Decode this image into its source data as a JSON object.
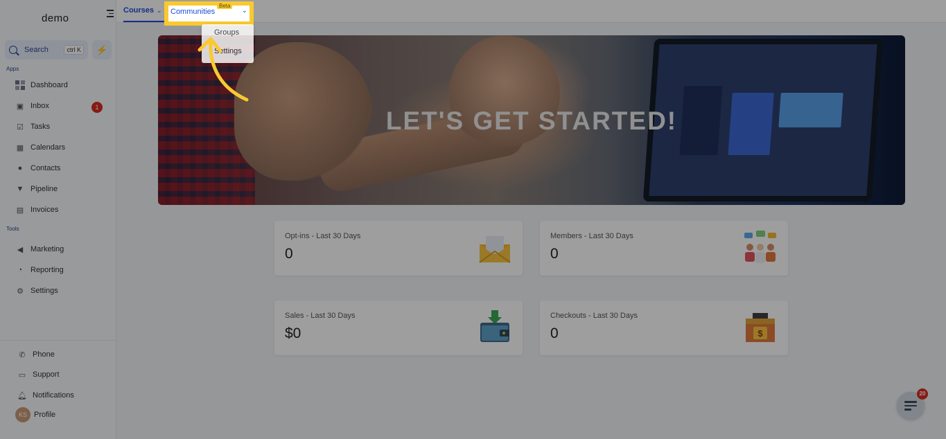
{
  "sidebar": {
    "logo": "demo",
    "search_label": "Search",
    "search_shortcut": "ctrl K",
    "apps_label": "Apps",
    "tools_label": "Tools",
    "apps": [
      {
        "label": "Dashboard",
        "icon": "dashboard-icon"
      },
      {
        "label": "Inbox",
        "icon": "inbox-icon",
        "badge": "1"
      },
      {
        "label": "Tasks",
        "icon": "tasks-icon"
      },
      {
        "label": "Calendars",
        "icon": "calendar-icon"
      },
      {
        "label": "Contacts",
        "icon": "contacts-icon"
      },
      {
        "label": "Pipeline",
        "icon": "pipeline-icon"
      },
      {
        "label": "Invoices",
        "icon": "invoice-icon"
      }
    ],
    "tools": [
      {
        "label": "Marketing",
        "icon": "megaphone-icon"
      },
      {
        "label": "Reporting",
        "icon": "pie-chart-icon"
      },
      {
        "label": "Settings",
        "icon": "gear-icon"
      }
    ],
    "footer": [
      {
        "label": "Phone",
        "icon": "phone-icon"
      },
      {
        "label": "Support",
        "icon": "support-icon"
      },
      {
        "label": "Notifications",
        "icon": "bell-icon"
      },
      {
        "label": "Profile",
        "icon": "avatar",
        "initials": "KS"
      }
    ]
  },
  "topbar": {
    "tabs": [
      {
        "label": "Courses",
        "active": true
      },
      {
        "label": "Communities",
        "badge": "Beta",
        "highlighted": true
      }
    ],
    "dropdown": [
      "Groups",
      "Settings"
    ]
  },
  "hero": {
    "title": "LET'S GET STARTED!"
  },
  "stats": [
    {
      "title": "Opt-ins - Last 30 Days",
      "value": "0",
      "icon": "envelope-icon"
    },
    {
      "title": "Members - Last 30 Days",
      "value": "0",
      "icon": "members-icon"
    },
    {
      "title": "Sales - Last 30 Days",
      "value": "$0",
      "icon": "wallet-icon"
    },
    {
      "title": "Checkouts - Last 30 Days",
      "value": "0",
      "icon": "cash-register-icon"
    }
  ],
  "chat": {
    "count": "20"
  },
  "colors": {
    "accent": "#1d4ed8",
    "highlight": "#f9c930",
    "badge": "#d92d20"
  }
}
